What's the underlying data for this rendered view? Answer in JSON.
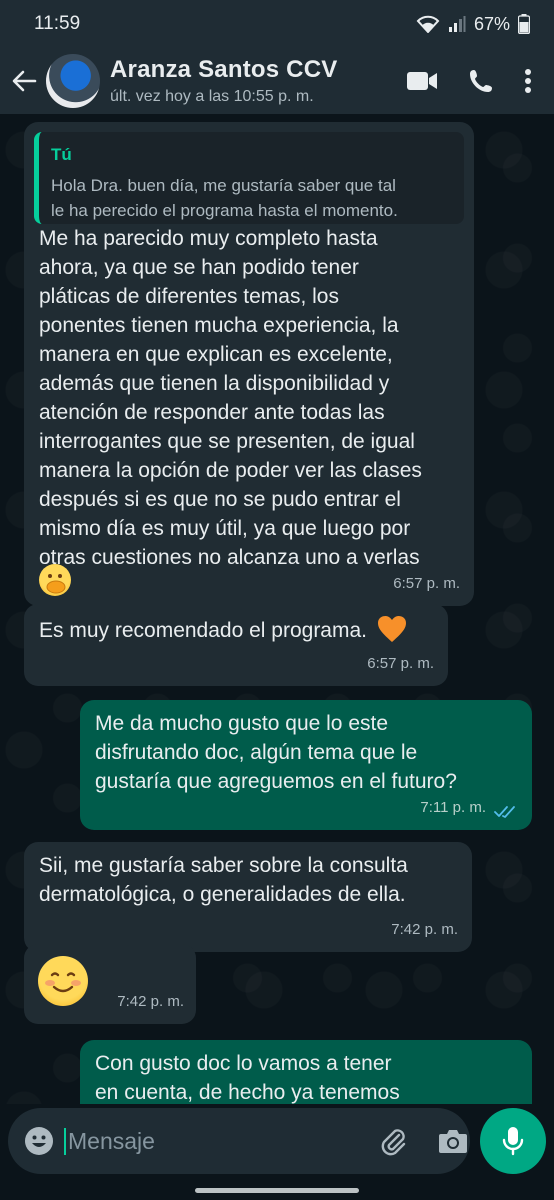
{
  "status_bar": {
    "time": "11:59",
    "battery": "67%"
  },
  "header": {
    "contact_name": "Aranza Santos CCV",
    "last_seen": "últ. vez hoy a las 10:55 p. m."
  },
  "messages": [
    {
      "direction": "incoming",
      "quote": {
        "author": "Tú",
        "lines": [
          "Hola Dra. buen día, me gustaría saber que tal",
          "le ha perecido el programa hasta el momento."
        ]
      },
      "lines": [
        "Me ha parecido muy completo hasta",
        "ahora, ya que se han podido tener",
        "pláticas de diferentes temas, los",
        "ponentes tienen mucha experiencia, la",
        "manera en que explican es excelente,",
        "además que tienen la disponibilidad y",
        "atención de responder ante todas las",
        "interrogantes que se presenten, de igual",
        "manera la opción de poder ver las clases",
        "después si es que no se pudo entrar el",
        "mismo día es muy útil, ya que luego por",
        "otras cuestiones no alcanza uno a verlas"
      ],
      "emoji": "face-with-hand-over-mouth",
      "time": "6:57 p. m."
    },
    {
      "direction": "incoming",
      "text": "Es muy recomendado el programa.",
      "emoji": "orange-heart",
      "time": "6:57 p. m."
    },
    {
      "direction": "outgoing",
      "lines": [
        "Me da mucho gusto que lo este",
        "disfrutando doc, algún tema que le",
        "gustaría que agreguemos en el futuro?"
      ],
      "time": "7:11 p. m.",
      "read_status": "double-check-read"
    },
    {
      "direction": "incoming",
      "lines": [
        "Sii, me gustaría saber sobre la consulta",
        "dermatológica, o generalidades de ella."
      ],
      "time": "7:42 p. m."
    },
    {
      "direction": "incoming",
      "emoji": "smiling-face",
      "time": "7:42 p. m."
    },
    {
      "direction": "outgoing",
      "lines": [
        "Con gusto doc lo vamos a tener",
        "en cuenta, de hecho ya tenemos"
      ]
    }
  ],
  "composer": {
    "placeholder": "Mensaje"
  },
  "colors": {
    "header_bg": "#1f2c34",
    "chat_bg": "#0b141a",
    "incoming_bubble": "#202c33",
    "outgoing_bubble": "#005c4b",
    "accent": "#00a884",
    "read_ticks": "#53bdeb"
  }
}
